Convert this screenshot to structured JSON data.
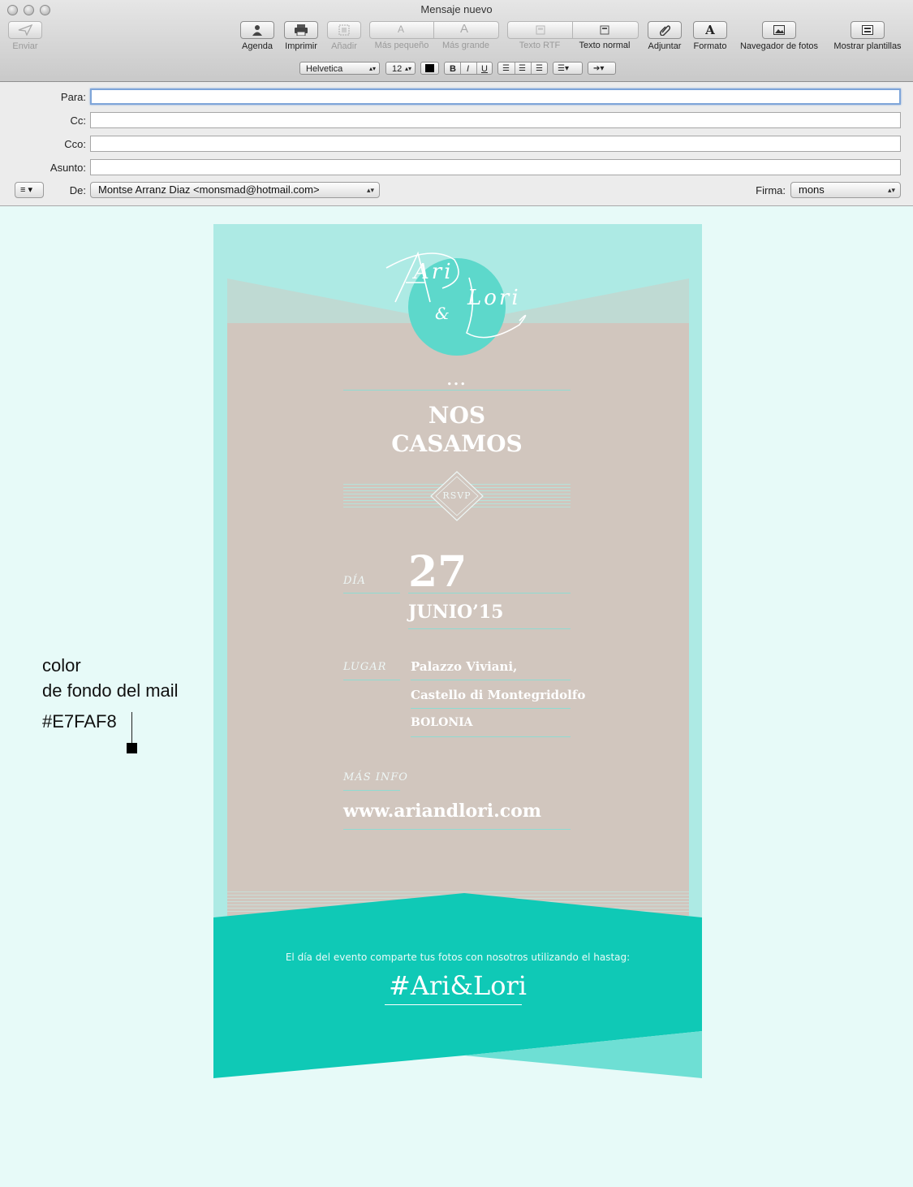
{
  "window": {
    "title": "Mensaje nuevo"
  },
  "toolbar": {
    "send": "Enviar",
    "contacts": "Agenda",
    "print": "Imprimir",
    "attach_inline": "Añadir",
    "smaller": "Más pequeño",
    "bigger": "Más grande",
    "rich_text": "Texto RTF",
    "plain_text": "Texto normal",
    "attach": "Adjuntar",
    "format": "Formato",
    "photo_browser": "Navegador de fotos",
    "templates": "Mostrar plantillas"
  },
  "format_bar": {
    "font": "Helvetica",
    "size": "12",
    "bold": "B",
    "italic": "I",
    "underline": "U"
  },
  "fields": {
    "to_label": "Para:",
    "cc_label": "Cc:",
    "bcc_label": "Cco:",
    "subject_label": "Asunto:",
    "from_label": "De:",
    "from_value": "Montse Arranz Diaz <monsmad@hotmail.com>",
    "signature_label": "Firma:",
    "signature_value": "mons"
  },
  "annotation": {
    "line1": "color",
    "line2": "de fondo del mail",
    "line3": "#E7FAF8"
  },
  "invitation": {
    "logo_line1": "Ari",
    "logo_amp": "&",
    "logo_line2": "Lori",
    "dots": "...",
    "heading1": "NOS",
    "heading2": "CASAMOS",
    "rsvp": "RSVP",
    "day_label": "DÍA",
    "day": "27",
    "month": "JUNIO’15",
    "place_label": "LUGAR",
    "place1": "Palazzo Viviani,",
    "place2": "Castello di Montegridolfo",
    "place3": "BOLONIA",
    "info_label": "MÁS INFO",
    "url": "www.ariandlori.com",
    "footer_text": "El día del evento comparte tus fotos con nosotros utilizando el hastag:",
    "hashtag": "#Ari&Lori"
  },
  "colors": {
    "mail_background": "#E7FAF8",
    "outer_band": "#ADEAE4",
    "card": "#D1C6BE",
    "circle": "#5DD8CB",
    "footer": "#0FC9B6",
    "footer_light": "#6EDFD4"
  }
}
